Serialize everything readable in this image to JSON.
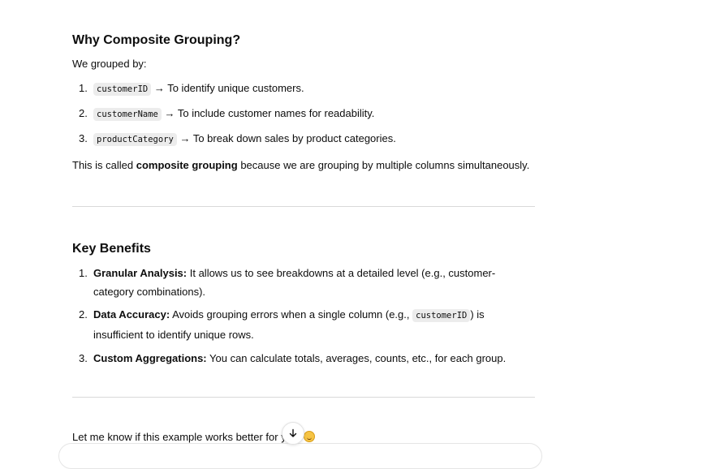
{
  "section1": {
    "heading": "Why Composite Grouping?",
    "intro": "We grouped by:",
    "items": [
      {
        "num": "1.",
        "code": "customerID",
        "text": " → To identify unique customers."
      },
      {
        "num": "2.",
        "code": "customerName",
        "text": " → To include customer names for readability."
      },
      {
        "num": "3.",
        "code": "productCategory",
        "text": " → To break down sales by product categories."
      }
    ],
    "summary_pre": "This is called ",
    "summary_bold": "composite grouping",
    "summary_post": " because we are grouping by multiple columns simultaneously."
  },
  "section2": {
    "heading": "Key Benefits",
    "items": [
      {
        "num": "1.",
        "bold": "Granular Analysis:",
        "text": " It allows us to see breakdowns at a detailed level (e.g., customer-category combinations)."
      },
      {
        "num": "2.",
        "bold": "Data Accuracy:",
        "text_pre": " Avoids grouping errors when a single column (e.g., ",
        "code": "customerID",
        "text_post": ") is insufficient to identify unique rows."
      },
      {
        "num": "3.",
        "bold": "Custom Aggregations:",
        "text": " You can calculate totals, averages, counts, etc., for each group."
      }
    ]
  },
  "closing": {
    "text": "Let me know if this example works better for you! "
  },
  "icons": {
    "scroll": "arrow-down-icon",
    "emoji": "smiling-face-emoji"
  }
}
